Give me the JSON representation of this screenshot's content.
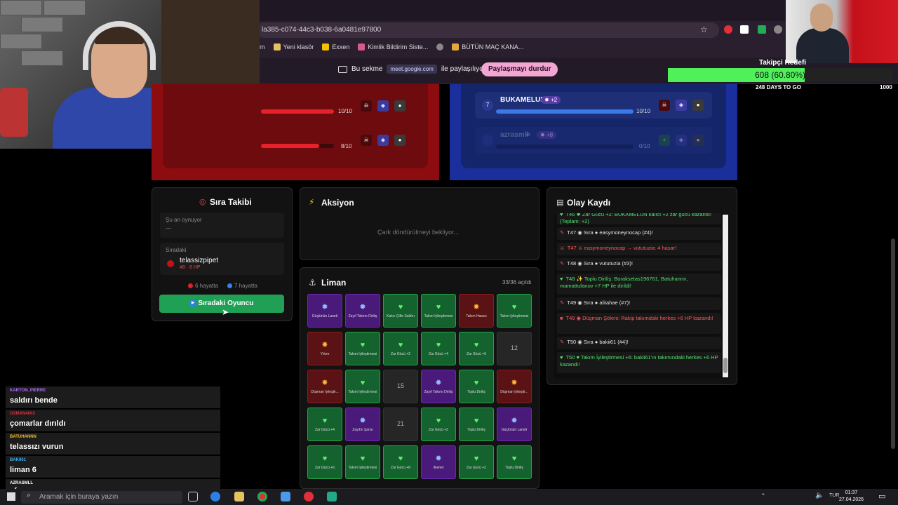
{
  "browser": {
    "url": "la385-c074-44c3-b038-6a0481e97800",
    "window_controls": [
      "—",
      "▢",
      "✕"
    ],
    "bookmarks": [
      {
        "label": "am",
        "color": "#e5c25c"
      },
      {
        "label": "Yeni klasör",
        "color": "#e5c25c"
      },
      {
        "label": "Exxen",
        "color": "#f2c200"
      },
      {
        "label": "Kimlik Bildirim Siste...",
        "color": "#d85a8a"
      },
      {
        "label": "",
        "color": "#888888"
      },
      {
        "label": "BÜTÜN MAÇ KANA...",
        "color": "#e5a83c"
      }
    ],
    "share": {
      "prefix": "Bu sekme",
      "domain": "meet.google.com",
      "suffix": "ile paylaşılıyor",
      "stop_label": "Paylaşmayı durdur"
    }
  },
  "goal": {
    "title": "Takipçi Hedefi",
    "progress_text": "608 (60.80%)",
    "fraction": 0.608,
    "min": "0",
    "max": "1000",
    "days_left": "248 DAYS TO GO"
  },
  "red_team": {
    "players": [
      {
        "hp_text": "10/10",
        "hp_fraction": 1.0
      },
      {
        "hp_text": "8/10",
        "hp_fraction": 0.8
      }
    ]
  },
  "blue_team": {
    "players": [
      {
        "num": "7",
        "name": "BUKAMELUN",
        "buff": "+2",
        "hp_text": "10/10",
        "hp_fraction": 1.0
      },
      {
        "num": "",
        "name": "azrasmll",
        "buff": "+8",
        "hp_text": "0/10",
        "hp_fraction": 0.0
      }
    ]
  },
  "turn": {
    "title": "Sıra Takibi",
    "now_label": "Şu an oynuyor",
    "now_value": "—",
    "next_label": "Sıradaki",
    "next_name": "telassizpipet",
    "next_detail": "#8 · 8 HP",
    "red_alive": "6 hayatta",
    "blue_alive": "7 hayatta",
    "button_label": "Sıradaki Oyuncu"
  },
  "action": {
    "title": "Aksiyon",
    "waiting": "Çark döndürülmeyi bekliyor..."
  },
  "harbor": {
    "title": "Liman",
    "count": "33/36 açıldı",
    "rows": [
      [
        {
          "style": "purple",
          "glyph": "✹",
          "label": "Güçlünün Laneti"
        },
        {
          "style": "purple",
          "glyph": "✹",
          "label": "Zayıf Takımı Diriliş"
        },
        {
          "style": "green",
          "glyph": "♥",
          "label": "Kalıcı Çifte Saldırı"
        },
        {
          "style": "green",
          "glyph": "♥",
          "label": "Takım İyileştirmesi"
        },
        {
          "style": "red",
          "glyph": "✸",
          "label": "Takım Hasarı"
        },
        {
          "style": "green",
          "glyph": "♥",
          "label": "Takım İyileştirmesi"
        }
      ],
      [
        {
          "style": "red",
          "glyph": "✸",
          "label": "Yıkım"
        },
        {
          "style": "green",
          "glyph": "♥",
          "label": "Takım İyileştirmesi"
        },
        {
          "style": "green",
          "glyph": "♥",
          "label": "Zar Gücü +2"
        },
        {
          "style": "green",
          "glyph": "♥",
          "label": "Zar Gücü +4"
        },
        {
          "style": "green",
          "glyph": "♥",
          "label": "Zar Gücü +6"
        },
        {
          "style": "empty",
          "glyph": "",
          "label": "12"
        }
      ],
      [
        {
          "style": "red",
          "glyph": "✸",
          "label": "Düşman İyileştir..."
        },
        {
          "style": "green",
          "glyph": "♥",
          "label": "Takım İyileştirmesi"
        },
        {
          "style": "empty",
          "glyph": "",
          "label": "15"
        },
        {
          "style": "purple",
          "glyph": "✹",
          "label": "Zayıf Takımı Diriliş"
        },
        {
          "style": "green",
          "glyph": "♥",
          "label": "Toplu Diriliş"
        },
        {
          "style": "red",
          "glyph": "✸",
          "label": "Düşman İyileştir..."
        }
      ],
      [
        {
          "style": "green",
          "glyph": "♥",
          "label": "Zar Gücü +4"
        },
        {
          "style": "purple",
          "glyph": "✹",
          "label": "Zayıfın Şansı"
        },
        {
          "style": "empty",
          "glyph": "",
          "label": "21"
        },
        {
          "style": "green",
          "glyph": "♥",
          "label": "Zar Gücü +2"
        },
        {
          "style": "green",
          "glyph": "♥",
          "label": "Toplu Diriliş"
        },
        {
          "style": "purple",
          "glyph": "✹",
          "label": "Güçlünün Laneti"
        }
      ],
      [
        {
          "style": "green",
          "glyph": "♥",
          "label": "Zar Gücü +6"
        },
        {
          "style": "green",
          "glyph": "♥",
          "label": "Takım İyileştirmesi"
        },
        {
          "style": "green",
          "glyph": "♥",
          "label": "Zar Gücü +8"
        },
        {
          "style": "purple",
          "glyph": "✹",
          "label": "İlkenet"
        },
        {
          "style": "green",
          "glyph": "♥",
          "label": "Zar Gücü +2"
        },
        {
          "style": "green",
          "glyph": "♥",
          "label": "Toplu Diriliş"
        }
      ]
    ]
  },
  "log": {
    "title": "Olay Kaydı",
    "entries": [
      {
        "icon": "♥",
        "tone": "green",
        "text": "T46 ✹ Zar Gücü +2: BUKAMELUN kalıcı +2 zar gücü kazandı! (Toplam: +2)"
      },
      {
        "icon": "✎",
        "tone": "white",
        "text": "T47 ◉ Sıra ● easymoneynocap (#4)!"
      },
      {
        "icon": "⚔",
        "tone": "red",
        "text": "T47 ⚔ easymoneynocap → vututuzia: 4 hasar!"
      },
      {
        "icon": "✎",
        "tone": "white",
        "text": "T48 ◉ Sıra ● vututuzia (#3)!"
      },
      {
        "icon": "♥",
        "tone": "green",
        "text": "T48 ✨ Toplu Diriliş: Buraksetas196761, Batuhannn, mamattufanov +7 HP ile dirildi!"
      },
      {
        "icon": "✎",
        "tone": "white",
        "text": "T49 ◉ Sıra ● alitahae (#7)!"
      },
      {
        "icon": "■",
        "tone": "red",
        "text": "T49 ◉ Düşman Şöleni: Rakip takımdaki herkes +6 HP kazandı!"
      },
      {
        "icon": "✎",
        "tone": "white",
        "text": "T50 ◉ Sıra ● bakii61 (#4)!"
      },
      {
        "icon": "♥",
        "tone": "green",
        "text": "T50 ♥ Takım İyileştirmesi +6: bakii61'ın takımındaki herkes +6 HP kazandı!"
      }
    ]
  },
  "chat": [
    {
      "user": "KARTON_PIERRE",
      "user_color": "#b06aff",
      "msg": "saldırı bende"
    },
    {
      "user": "OSMAN4003",
      "user_color": "#e0303a",
      "msg": "çomarlar dırıldı"
    },
    {
      "user": "BATUHANNN",
      "user_color": "#f0c030",
      "msg": "telassızı vurun"
    },
    {
      "user": "BAKII61",
      "user_color": "#40b0f0",
      "msg": "liman 6"
    },
    {
      "user": "AZRASMLL",
      "user_color": "#ffffff",
      "msg": "ef"
    }
  ],
  "taskbar": {
    "search_placeholder": "Aramak için buraya yazın",
    "lang": "TUR",
    "time": "01:37",
    "date": "27.04.2026"
  }
}
